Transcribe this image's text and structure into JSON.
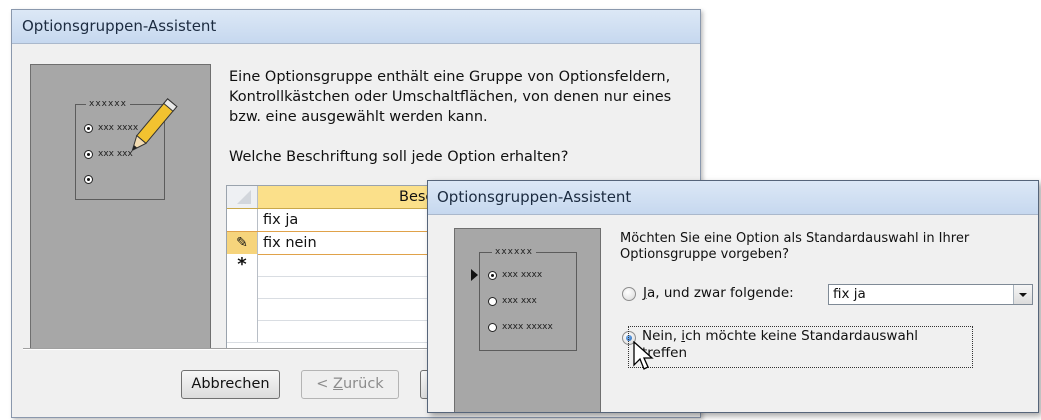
{
  "back_dialog": {
    "title": "Optionsgruppen-Assistent",
    "illustration": {
      "legend": "xxxxxx",
      "options": [
        "xxx xxxx",
        "xxx xxx",
        ""
      ]
    },
    "description": "Eine Optionsgruppe enthält eine Gruppe von Optionsfeldern, Kontrollkästchen oder Umschaltflächen, von denen nur eines bzw. eine ausgewählt werden kann.",
    "question": "Welche Beschriftung soll jede Option erhalten?",
    "grid": {
      "column_header": "Beschriftungen",
      "rows": [
        {
          "selector": "",
          "value": "fix ja"
        },
        {
          "selector": "✎",
          "value": "fix nein"
        },
        {
          "selector": "*",
          "value": ""
        }
      ]
    },
    "buttons": {
      "cancel": "Abbrechen",
      "back_prefix": "< ",
      "back_accel": "Z",
      "back_rest": "urück"
    }
  },
  "front_dialog": {
    "title": "Optionsgruppen-Assistent",
    "illustration": {
      "legend": "xxxxxx",
      "options": [
        "xxx xxxx",
        "xxx xxx",
        "xxxx xxxxx"
      ]
    },
    "question": "Möchten Sie eine Option als Standardauswahl in Ihrer Optionsgruppe vorgeben?",
    "option_yes": {
      "accel": "J",
      "rest": "a, und zwar folgende:"
    },
    "default_value": "fix ja",
    "option_no": {
      "prefix": "Nein, ",
      "accel": "i",
      "rest": "ch möchte keine Standardauswahl treffen"
    },
    "selected_option": "no"
  }
}
